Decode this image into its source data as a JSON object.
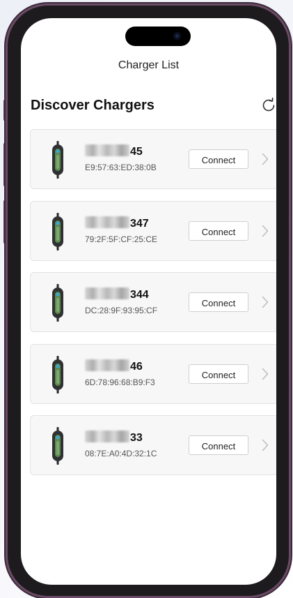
{
  "nav": {
    "title": "Charger List"
  },
  "header": {
    "title": "Discover Chargers",
    "refresh_icon": "refresh-icon"
  },
  "button_label": "Connect",
  "chargers": [
    {
      "name_suffix": "45",
      "mac": "E9:57:63:ED:38:0B"
    },
    {
      "name_suffix": "347",
      "mac": "79:2F:5F:CF:25:CE"
    },
    {
      "name_suffix": "344",
      "mac": "DC:28:9F:93:95:CF"
    },
    {
      "name_suffix": "46",
      "mac": "6D:78:96:68:B9:F3"
    },
    {
      "name_suffix": "33",
      "mac": "08:7E:A0:4D:32:1C"
    }
  ],
  "colors": {
    "screen_bg": "#ffffff",
    "card_bg": "#f7f7f7",
    "card_border": "#e2e2e2",
    "frame": "#1d1b1e"
  }
}
